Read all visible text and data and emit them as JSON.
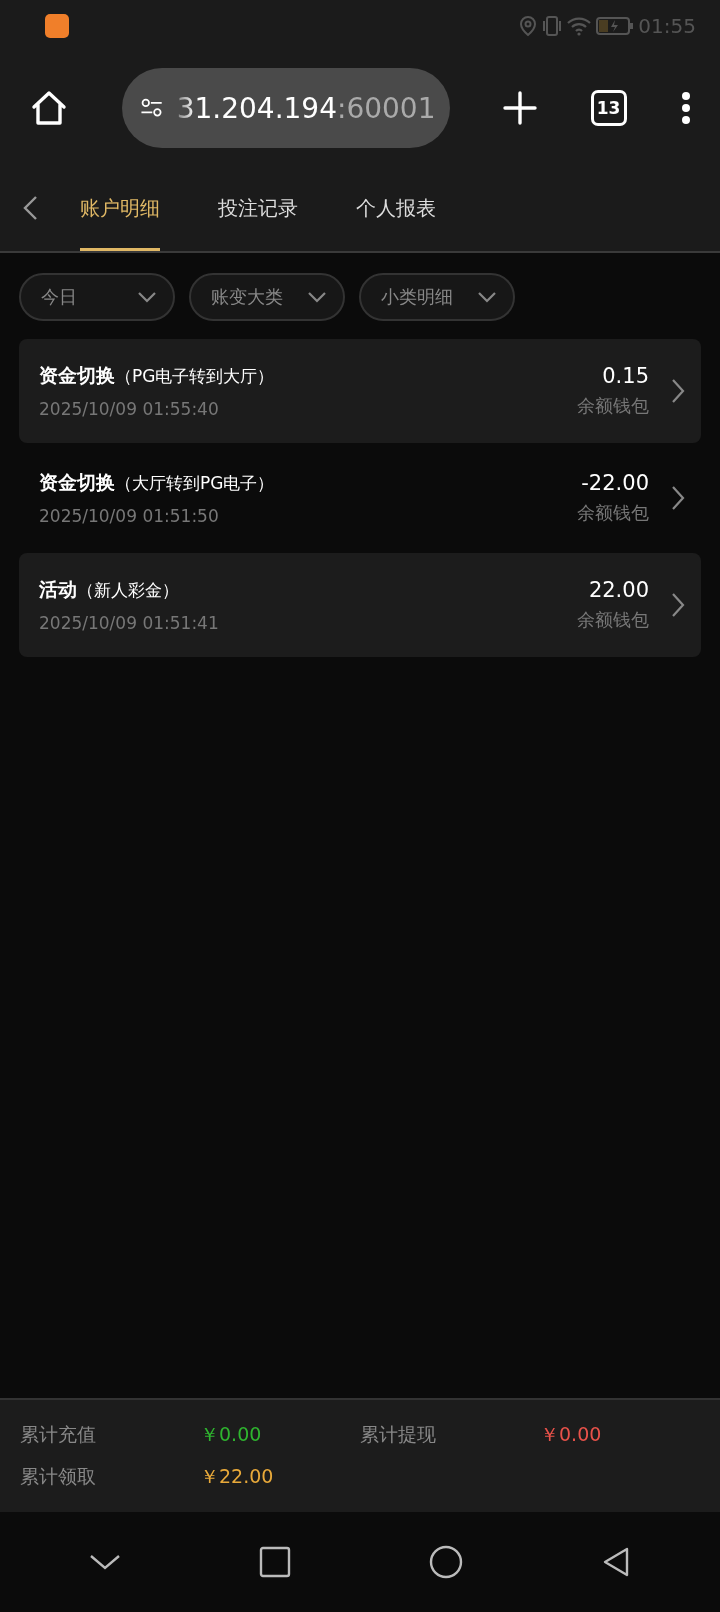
{
  "status_bar": {
    "time": "01:55"
  },
  "browser": {
    "url_host": "31.204.194",
    "url_port": ":60001",
    "tab_count": "13"
  },
  "tabs": [
    {
      "label": "账户明细",
      "selected": true
    },
    {
      "label": "投注记录",
      "selected": false
    },
    {
      "label": "个人报表",
      "selected": false
    }
  ],
  "filters": [
    {
      "label": "今日"
    },
    {
      "label": "账变大类"
    },
    {
      "label": "小类明细"
    }
  ],
  "records": [
    {
      "title": "资金切换",
      "detail": "（PG电子转到大厅）",
      "time": "2025/10/09 01:55:40",
      "amount": "0.15",
      "wallet": "余额钱包"
    },
    {
      "title": "资金切换",
      "detail": "（大厅转到PG电子）",
      "time": "2025/10/09 01:51:50",
      "amount": "-22.00",
      "wallet": "余额钱包"
    },
    {
      "title": "活动",
      "detail": "（新人彩金）",
      "time": "2025/10/09 01:51:41",
      "amount": "22.00",
      "wallet": "余额钱包"
    }
  ],
  "summary": [
    {
      "label": "累计充值",
      "value": "￥0.00",
      "color": "#2fb52f"
    },
    {
      "label": "累计提现",
      "value": "￥0.00",
      "color": "#e8524a"
    },
    {
      "label": "累计领取",
      "value": "￥22.00",
      "color": "#e8a93a"
    }
  ]
}
